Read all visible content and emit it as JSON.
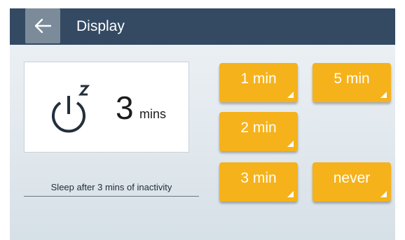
{
  "header": {
    "title": "Display",
    "back_icon": "arrow-left-icon"
  },
  "status": {
    "icon": "power-sleep-icon",
    "value": "3",
    "unit": "mins"
  },
  "caption": "Sleep after 3 mins of inactivity",
  "options": [
    {
      "label": "1 min"
    },
    {
      "label": "5 min"
    },
    {
      "label": "2 min"
    },
    {
      "label": "3 min"
    },
    {
      "label": "never"
    }
  ],
  "colors": {
    "header": "#344a63",
    "button": "#f6b21a",
    "button_text": "#ffffff"
  }
}
